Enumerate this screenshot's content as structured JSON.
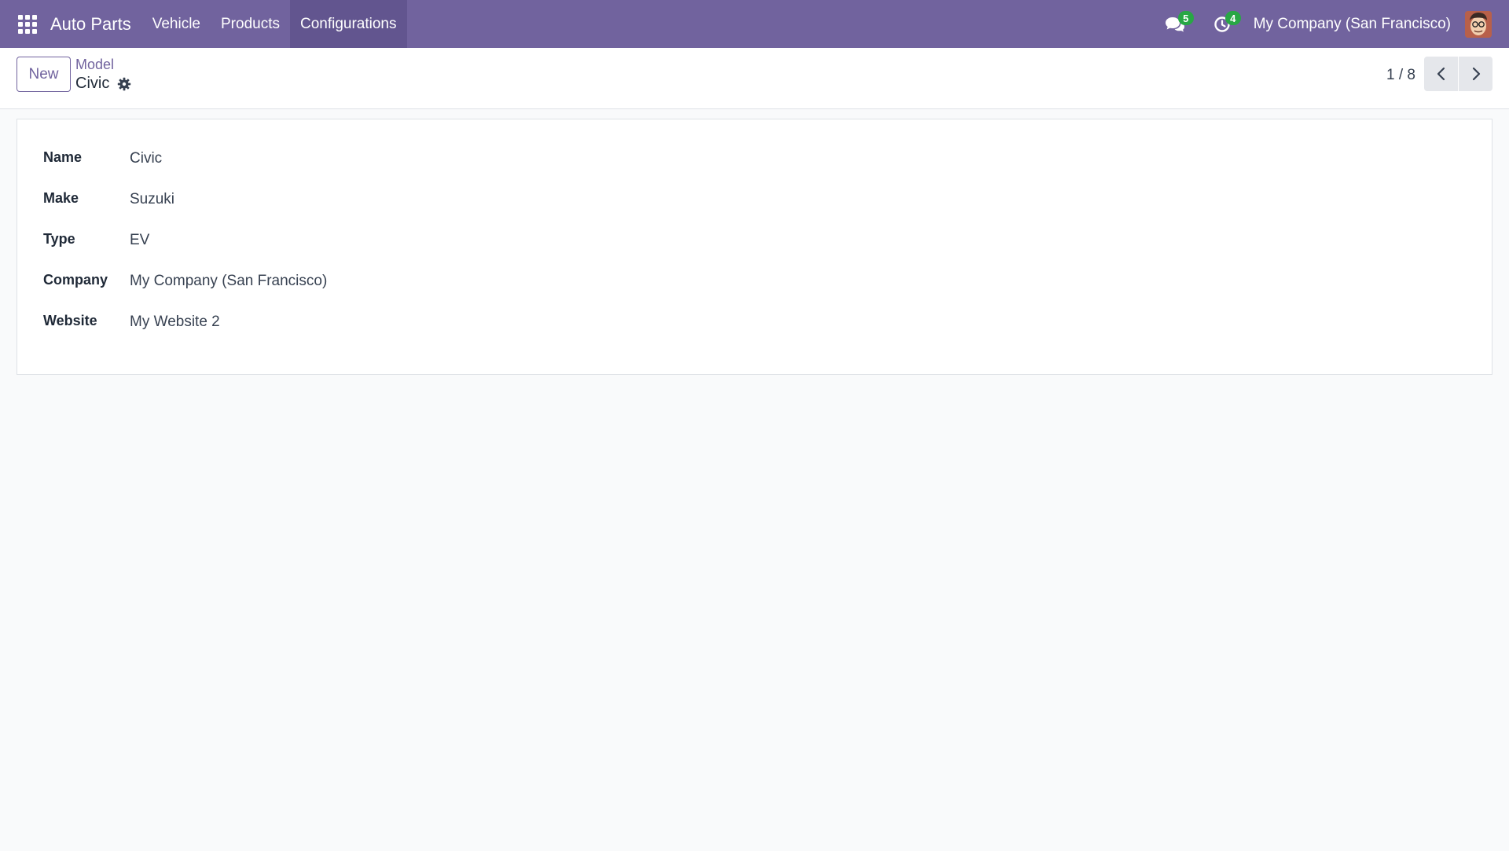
{
  "navbar": {
    "brand": "Auto Parts",
    "menu": [
      {
        "label": "Vehicle",
        "active": false
      },
      {
        "label": "Products",
        "active": false
      },
      {
        "label": "Configurations",
        "active": true
      }
    ],
    "messages_count": "5",
    "activities_count": "4",
    "company": "My Company (San Francisco)"
  },
  "control_panel": {
    "new_label": "New",
    "breadcrumb_parent": "Model",
    "breadcrumb_current": "Civic",
    "pager": "1 / 8"
  },
  "form": {
    "fields": [
      {
        "label": "Name",
        "value": "Civic"
      },
      {
        "label": "Make",
        "value": "Suzuki"
      },
      {
        "label": "Type",
        "value": "EV"
      },
      {
        "label": "Company",
        "value": "My Company (San Francisco)"
      },
      {
        "label": "Website",
        "value": "My Website 2"
      }
    ]
  },
  "colors": {
    "brand": "#71639e",
    "badge": "#28a745"
  }
}
